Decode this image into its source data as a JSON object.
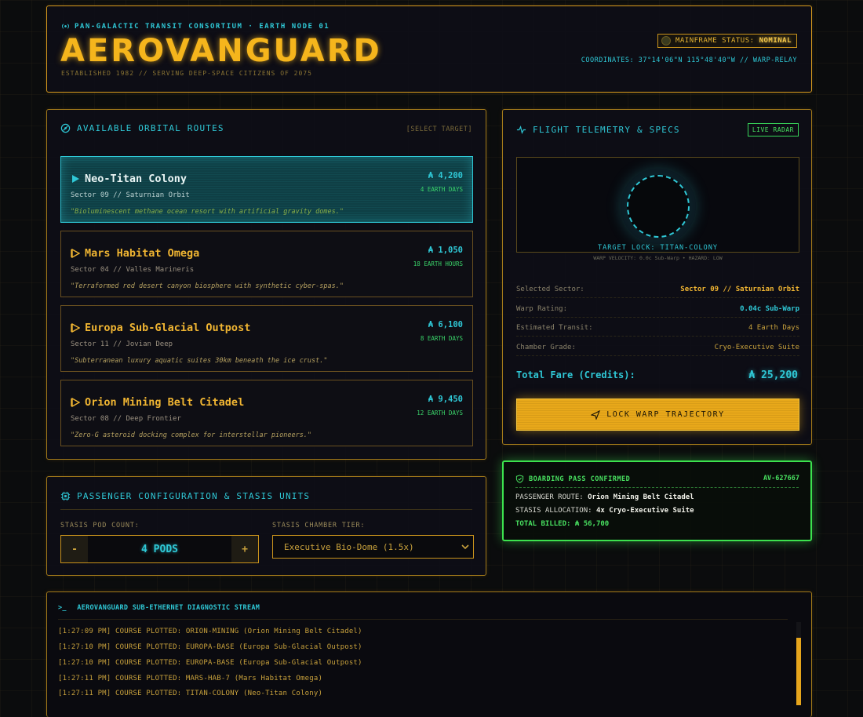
{
  "header": {
    "kicker": "PAN-GALACTIC TRANSIT CONSORTIUM · EARTH NODE 01",
    "title": "AEROVANGUARD",
    "subtitle": "ESTABLISHED 1982 // SERVING DEEP-SPACE CITIZENS OF 2075",
    "status_label": "MAINFRAME STATUS:",
    "status_value": "NOMINAL",
    "coordinates": "COORDINATES: 37°14'06\"N 115°48'40\"W // WARP-RELAY"
  },
  "routes": {
    "title": "AVAILABLE ORBITAL ROUTES",
    "select_hint": "[SELECT TARGET]",
    "items": [
      {
        "name": "Neo-Titan Colony",
        "sector": "Sector 09 // Saturnian Orbit",
        "price": "₳ 4,200",
        "duration": "4 EARTH DAYS",
        "description": "\"Bioluminescent methane ocean resort with artificial gravity domes.\"",
        "active": true
      },
      {
        "name": "Mars Habitat Omega",
        "sector": "Sector 04 // Valles Marineris",
        "price": "₳ 1,050",
        "duration": "18 EARTH HOURS",
        "description": "\"Terraformed red desert canyon biosphere with synthetic cyber-spas.\"",
        "active": false
      },
      {
        "name": "Europa Sub-Glacial Outpost",
        "sector": "Sector 11 // Jovian Deep",
        "price": "₳ 6,100",
        "duration": "8 EARTH DAYS",
        "description": "\"Subterranean luxury aquatic suites 30km beneath the ice crust.\"",
        "active": false
      },
      {
        "name": "Orion Mining Belt Citadel",
        "sector": "Sector 08 // Deep Frontier",
        "price": "₳ 9,450",
        "duration": "12 EARTH DAYS",
        "description": "\"Zero-G asteroid docking complex for interstellar pioneers.\"",
        "active": false
      }
    ]
  },
  "telemetry": {
    "title": "FLIGHT TELEMETRY & SPECS",
    "radar_badge": "LIVE RADAR",
    "target_lock": "TARGET LOCK: TITAN-COLONY",
    "radar_meta": "WARP VELOCITY: 0.0c Sub-Warp • HAZARD: LOW",
    "specs": [
      {
        "label": "Selected Sector:",
        "value": "Sector 09 // Saturnian Orbit"
      },
      {
        "label": "Warp Rating:",
        "value": "0.04c Sub-Warp"
      },
      {
        "label": "Estimated Transit:",
        "value": "4 Earth Days"
      },
      {
        "label": "Chamber Grade:",
        "value": "Cryo-Executive Suite"
      }
    ],
    "total_label": "Total Fare (Credits):",
    "total_value": "₳ 25,200",
    "lock_button": "LOCK WARP TRAJECTORY"
  },
  "config": {
    "title": "PASSENGER CONFIGURATION & STASIS UNITS",
    "pod_label": "STASIS POD COUNT:",
    "minus": "-",
    "plus": "+",
    "pod_value": "4 PODS",
    "tier_label": "STASIS CHAMBER TIER:",
    "tier_value": "Executive Bio-Dome (1.5x)"
  },
  "boarding": {
    "title": "BOARDING PASS CONFIRMED",
    "id": "AV-627667",
    "route_label": "PASSENGER ROUTE:",
    "route_value": "Orion Mining Belt Citadel",
    "stasis_label": "STASIS ALLOCATION:",
    "stasis_value": "4x Cryo-Executive Suite",
    "total": "TOTAL BILLED: ₳ 56,700"
  },
  "terminal": {
    "prompt": ">_",
    "title": "AEROVANGUARD SUB-ETHERNET DIAGNOSTIC STREAM",
    "lines": [
      "[1:27:09 PM] COURSE PLOTTED: ORION-MINING (Orion Mining Belt Citadel)",
      "[1:27:10 PM] COURSE PLOTTED: EUROPA-BASE (Europa Sub-Glacial Outpost)",
      "[1:27:10 PM] COURSE PLOTTED: EUROPA-BASE (Europa Sub-Glacial Outpost)",
      "[1:27:11 PM] COURSE PLOTTED: MARS-HAB-7 (Mars Habitat Omega)",
      "[1:27:11 PM] COURSE PLOTTED: TITAN-COLONY (Neo-Titan Colony)"
    ]
  },
  "colors": {
    "amber": "#f0b532",
    "cyan": "#2fc8d6",
    "green": "#48e060",
    "background": "#0b0c0d"
  },
  "icons": {
    "header": "broadcast-icon",
    "routes": "orbit-icon",
    "route": "play-triangle-icon",
    "telemetry": "pulse-icon",
    "config": "chip-icon",
    "boarding": "shield-check-icon",
    "lock_button": "send-icon",
    "select": "chevron-down-icon"
  }
}
